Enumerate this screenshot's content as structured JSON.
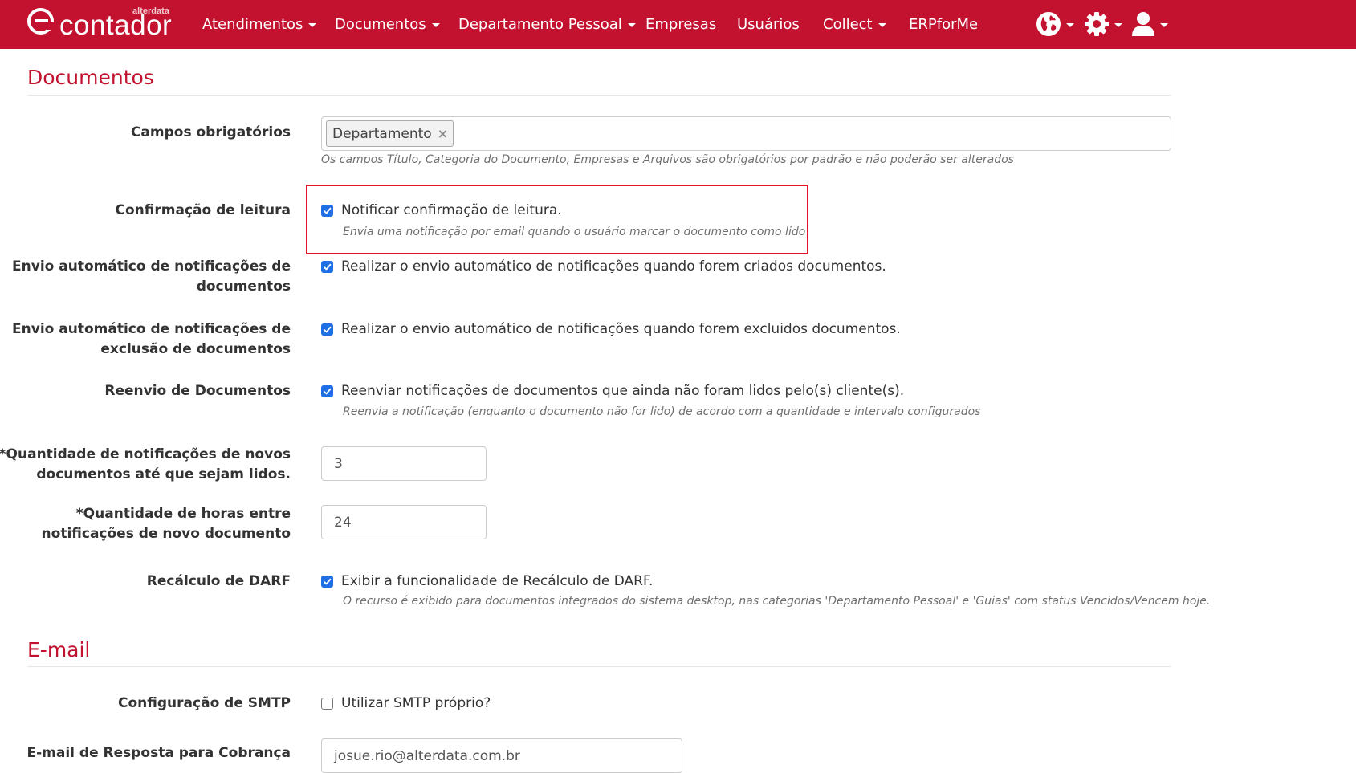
{
  "brand": {
    "name": "contador",
    "sub": "alterdata"
  },
  "nav": {
    "items": [
      {
        "label": "Atendimentos",
        "dropdown": true
      },
      {
        "label": "Documentos",
        "dropdown": true
      },
      {
        "label": "Departamento Pessoal",
        "dropdown": true
      },
      {
        "label": "Empresas",
        "dropdown": false
      },
      {
        "label": "Usuários",
        "dropdown": false
      },
      {
        "label": "Collect",
        "dropdown": true
      },
      {
        "label": "ERPforMe",
        "dropdown": false
      }
    ],
    "icons": [
      "globe-icon",
      "gear-icon",
      "user-icon"
    ]
  },
  "colors": {
    "brand": "#c3122f",
    "checkbox": "#1f6fe5",
    "highlight": "#e0142b"
  },
  "documentos": {
    "title": "Documentos",
    "campos": {
      "label": "Campos obrigatórios",
      "tag": "Departamento",
      "tag_remove": "×",
      "help": "Os campos Título, Categoria do Documento, Empresas e Arquivos são obrigatórios por padrão e não poderão ser alterados"
    },
    "confirmacao": {
      "label": "Confirmação de leitura",
      "checked": true,
      "text": "Notificar confirmação de leitura.",
      "help": "Envia uma notificação por email quando o usuário marcar o documento como lido"
    },
    "envio_auto": {
      "label_line1": "Envio automático de notificações de",
      "label_line2": "documentos",
      "checked": true,
      "text": "Realizar o envio automático de notificações quando forem criados documentos."
    },
    "envio_exclusao": {
      "label_line1": "Envio automático de notificações de",
      "label_line2": "exclusão de documentos",
      "checked": true,
      "text": "Realizar o envio automático de notificações quando forem excluidos documentos."
    },
    "reenvio": {
      "label": "Reenvio de Documentos",
      "checked": true,
      "text": "Reenviar notificações de documentos que ainda não foram lidos pelo(s) cliente(s).",
      "help": "Reenvia a notificação (enquanto o documento não for lido) de acordo com a quantidade e intervalo configurados"
    },
    "quantidade": {
      "label_line1": "*Quantidade de notificações de novos",
      "label_line2": "documentos até que sejam lidos.",
      "value": "3"
    },
    "horas": {
      "label_line1": "*Quantidade de horas entre",
      "label_line2": "notificações de novo documento",
      "value": "24"
    },
    "darf": {
      "label": "Recálculo de DARF",
      "checked": true,
      "text": "Exibir a funcionalidade de Recálculo de DARF.",
      "help": "O recurso é exibido para documentos integrados do sistema desktop, nas categorias 'Departamento Pessoal' e 'Guias' com status Vencidos/Vencem hoje."
    }
  },
  "email": {
    "title": "E-mail",
    "smtp": {
      "label": "Configuração de SMTP",
      "checked": false,
      "text": "Utilizar SMTP próprio?"
    },
    "resposta": {
      "label": "E-mail de Resposta para Cobrança",
      "value": "josue.rio@alterdata.com.br"
    }
  }
}
